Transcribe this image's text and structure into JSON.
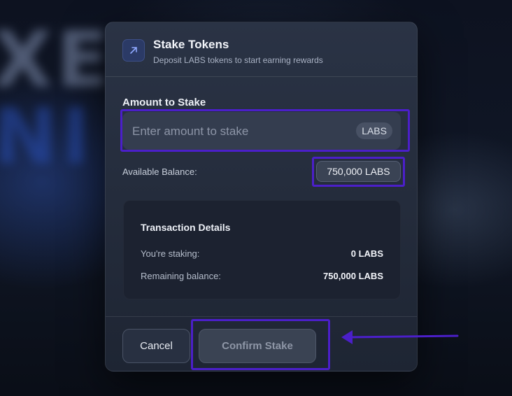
{
  "background": {
    "blurred_text_line1": "XE",
    "blurred_text_line2": "NI"
  },
  "modal": {
    "icon": "arrow-up-right-icon",
    "title": "Stake Tokens",
    "subtitle": "Deposit LABS tokens to start earning rewards"
  },
  "amount": {
    "label": "Amount to Stake",
    "placeholder": "Enter amount to stake",
    "value": "",
    "unit": "LABS"
  },
  "balance": {
    "label": "Available Balance:",
    "value": "750,000 LABS"
  },
  "transaction": {
    "title": "Transaction Details",
    "rows": [
      {
        "label": "You're staking:",
        "value": "0 LABS"
      },
      {
        "label": "Remaining balance:",
        "value": "750,000 LABS"
      }
    ]
  },
  "footer": {
    "cancel_label": "Cancel",
    "confirm_label": "Confirm Stake"
  },
  "colors": {
    "highlight": "#4b1fc9",
    "accent": "#2b3a66"
  }
}
